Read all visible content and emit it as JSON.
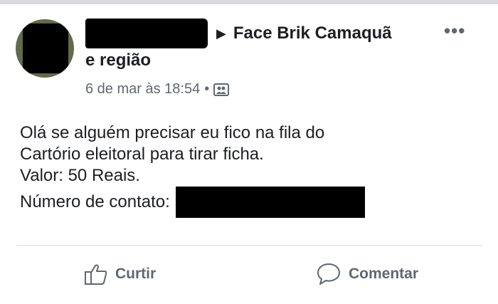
{
  "post": {
    "group_name_first": "Face Brik Camaquã",
    "group_name_second": "e região",
    "timestamp": "6 de mar às 18:54",
    "separator": "•",
    "more_label": "•••",
    "text_lines": [
      "Olá se alguém precisar eu fico na fila do",
      "Cartório eleitoral para tirar ficha.",
      " Valor: 50 Reais.",
      " Número de contato:"
    ]
  },
  "actions": {
    "like_label": "Curtir",
    "comment_label": "Comentar"
  },
  "icons": {
    "audience": "group-audience-icon",
    "like": "thumbs-up-icon",
    "comment": "speech-bubble-icon",
    "more": "more-options-icon",
    "arrow": "right-triangle-icon"
  },
  "colors": {
    "text": "#1c1e21",
    "muted": "#606770",
    "divider": "#dadde1",
    "redaction": "#000000"
  }
}
